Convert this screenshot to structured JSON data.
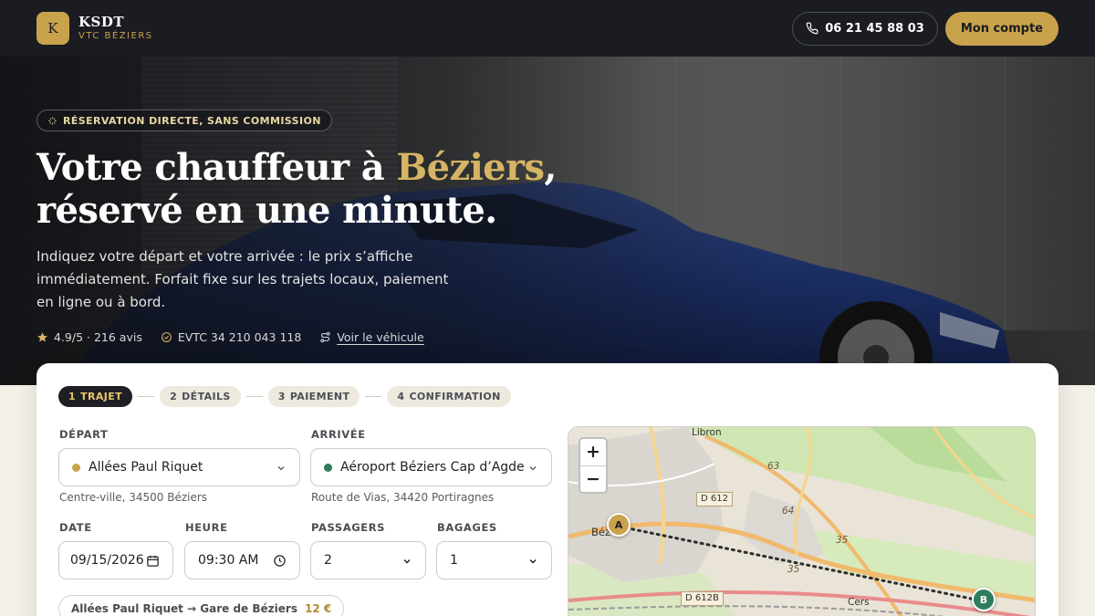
{
  "header": {
    "logo_letter": "K",
    "brand_name": "KSDT",
    "brand_sub": "VTC BÉZIERS",
    "phone": "06 21 45 88 03",
    "account_label": "Mon compte"
  },
  "hero": {
    "tagline": "RÉSERVATION DIRECTE, SANS COMMISSION",
    "title_part1": "Votre chauffeur à ",
    "title_highlight": "Béziers",
    "title_part2": ",",
    "title_line2": "réservé en une minute.",
    "lead": "Indiquez votre départ et votre arrivée : le prix s’affiche immédiatement. Forfait fixe sur les trajets locaux, paiement en ligne ou à bord.",
    "rating": "4.9/5 · 216 avis",
    "license": "EVTC 34 210 043 118",
    "vehicle_link": "Voir le véhicule"
  },
  "booking": {
    "steps": [
      {
        "num": "1",
        "label": "TRAJET",
        "active": true
      },
      {
        "num": "2",
        "label": "DÉTAILS",
        "active": false
      },
      {
        "num": "3",
        "label": "PAIEMENT",
        "active": false
      },
      {
        "num": "4",
        "label": "CONFIRMATION",
        "active": false
      }
    ],
    "departure": {
      "label": "DÉPART",
      "value": "Allées Paul Riquet",
      "address": "Centre-ville, 34500 Béziers",
      "dot_color": "#c9a24c"
    },
    "arrival": {
      "label": "ARRIVÉE",
      "value": "Aéroport Béziers Cap d’Agde",
      "address": "Route de Vias, 34420 Portiragnes",
      "dot_color": "#2e7d5b"
    },
    "date": {
      "label": "DATE",
      "value": "09/15/2026"
    },
    "time": {
      "label": "HEURE",
      "value": "09:30 AM"
    },
    "passengers": {
      "label": "PASSAGERS",
      "value": "2"
    },
    "luggage": {
      "label": "BAGAGES",
      "value": "1"
    },
    "suggestion": {
      "route": "Allées Paul Riquet → Gare de Béziers",
      "price": "12 €"
    }
  },
  "map": {
    "zoom_in": "+",
    "zoom_out": "−",
    "places": [
      "Libron",
      "Béz",
      "Cers"
    ],
    "roads": [
      "D 612",
      "D 612B",
      "63",
      "64",
      "35",
      "35"
    ],
    "marker_a": "A",
    "marker_b": "B"
  },
  "colors": {
    "accent": "#c9a24c",
    "dark": "#1a1c21",
    "arrival": "#2e7d5b"
  }
}
